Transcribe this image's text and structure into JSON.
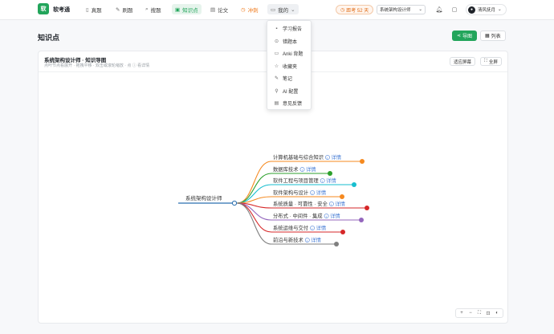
{
  "header": {
    "logo_text": "软",
    "brand": "软考通",
    "nav": [
      {
        "label": "真题",
        "icon": "book-icon",
        "glyph": "▯"
      },
      {
        "label": "刷题",
        "icon": "pencil-icon",
        "glyph": "✎"
      },
      {
        "label": "搜题",
        "icon": "search-icon",
        "glyph": "⌕"
      },
      {
        "label": "知识点",
        "icon": "knowledge-icon",
        "glyph": "▣"
      },
      {
        "label": "论文",
        "icon": "document-icon",
        "glyph": "▤"
      },
      {
        "label": "冲刺",
        "icon": "timer-icon",
        "glyph": "◷"
      },
      {
        "label": "我的",
        "icon": "briefcase-icon",
        "glyph": "▭"
      }
    ],
    "countdown": "距考 52 天",
    "subject": "系统架构设计师",
    "user": "清风抚月"
  },
  "dropdown": {
    "items": [
      {
        "label": "学习报告",
        "icon": "report-icon",
        "glyph": "▪"
      },
      {
        "label": "错题本",
        "icon": "error-book-icon",
        "glyph": "⊙"
      },
      {
        "label": "Anki 背题",
        "icon": "anki-icon",
        "glyph": "▭"
      },
      {
        "label": "收藏夹",
        "icon": "star-icon",
        "glyph": "☆"
      },
      {
        "label": "笔记",
        "icon": "note-icon",
        "glyph": "✎"
      },
      {
        "label": "AI 配置",
        "icon": "ai-config-icon",
        "glyph": "⚲"
      },
      {
        "label": "意见反馈",
        "icon": "feedback-icon",
        "glyph": "▤"
      }
    ]
  },
  "page": {
    "title": "知识点",
    "export_label": "导图",
    "list_label": "列表"
  },
  "card": {
    "title": "系统架构设计师 · 知识导图",
    "subtitle": "点叶节点看展开 · 拖拽平移 · 双击或滚轮缩放 · 点 ⓘ 看详情",
    "fit_label": "适应屏幕",
    "fullscreen_label": "全屏"
  },
  "mindmap": {
    "root": "系统架构设计师",
    "detail_label": "详情",
    "branches": [
      {
        "label": "计算机基础与综合知识",
        "color": "#f5891f"
      },
      {
        "label": "数据库技术",
        "color": "#2ca02c"
      },
      {
        "label": "软件工程与项目管理",
        "color": "#17becf"
      },
      {
        "label": "软件架构与设计",
        "color": "#f5891f"
      },
      {
        "label": "系统质量 · 可靠性 · 安全",
        "color": "#d62728"
      },
      {
        "label": "分布式 · 中间件 · 集成",
        "color": "#9467bd"
      },
      {
        "label": "系统运维与交付",
        "color": "#d62728"
      },
      {
        "label": "前沿与新技术",
        "color": "#7f7f7f"
      }
    ]
  },
  "zoom_toolbar": [
    {
      "glyph": "+",
      "icon": "zoom-in-icon"
    },
    {
      "glyph": "−",
      "icon": "zoom-out-icon"
    },
    {
      "glyph": "⛶",
      "icon": "fit-icon"
    },
    {
      "glyph": "⊡",
      "icon": "reset-icon"
    },
    {
      "glyph": "◐",
      "icon": "theme-icon"
    }
  ]
}
